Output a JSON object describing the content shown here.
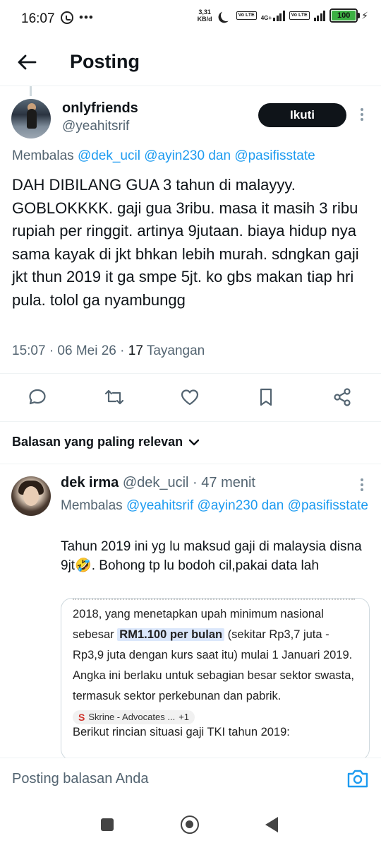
{
  "status_bar": {
    "time": "16:07",
    "more_dots": "•••",
    "net_speed_value": "3,31",
    "net_speed_unit": "KB/d",
    "volte_label": "Vo LTE",
    "network_label": "4G+",
    "battery_level": "100"
  },
  "header": {
    "title": "Posting"
  },
  "post": {
    "display_name": "onlyfriends",
    "handle": "@yeahitsrif",
    "follow_label": "Ikuti",
    "reply_prefix": "Membalas",
    "reply_mention_1": "@dek_ucil",
    "reply_mention_2": "@ayin230",
    "reply_and": "dan",
    "reply_mention_3": "@pasifisstate",
    "text": "DAH DIBILANG GUA 3 tahun di malayyy. GOBLOKKKK. gaji gua 3ribu. masa it masih 3 ribu rupiah per ringgit. artinya 9jutaan. biaya hidup nya sama kayak di jkt bhkan lebih murah. sdngkan gaji jkt thun 2019 it ga smpe 5jt. ko gbs makan tiap hri pula. tolol ga nyambungg",
    "timestamp": "15:07 · 06 Mei 26 · ",
    "views_count": "17",
    "views_label": " Tayangan"
  },
  "sort": {
    "label": "Balasan yang paling relevan"
  },
  "reply": {
    "display_name": "dek irma",
    "handle_time": " @dek_ucil · 47 menit",
    "reply_prefix": "Membalas",
    "reply_mention_1": "@yeahitsrif",
    "reply_mention_2": "@ayin230",
    "reply_and": "dan",
    "reply_mention_3": "@pasifisstate",
    "text": "Tahun 2019 ini yg lu maksud gaji di malaysia disna 9jt🤣. Bohong tp lu bodoh cil,pakai data lah",
    "embed": {
      "line_a": "2018, yang menetapkan upah minimum nasional sebesar ",
      "highlight": "RM1.100 per bulan",
      "line_b": " (sekitar Rp3,7 juta - Rp3,9 juta dengan kurs saat itu) mulai 1 Januari 2019. Angka ini berlaku untuk sebagian besar sektor swasta, termasuk sektor perkebunan dan pabrik. ",
      "chip_letter": "S",
      "chip_source": "Skrine - Advocates ...",
      "chip_more": "+1",
      "line_c": "Berikut rincian situasi gaji TKI tahun 2019:"
    }
  },
  "compose": {
    "placeholder": "Posting balasan Anda"
  },
  "colors": {
    "accent": "#1d9bf0",
    "text": "#0f1419",
    "secondary": "#536471",
    "border": "#eff3f4",
    "battery": "#3cb043"
  }
}
